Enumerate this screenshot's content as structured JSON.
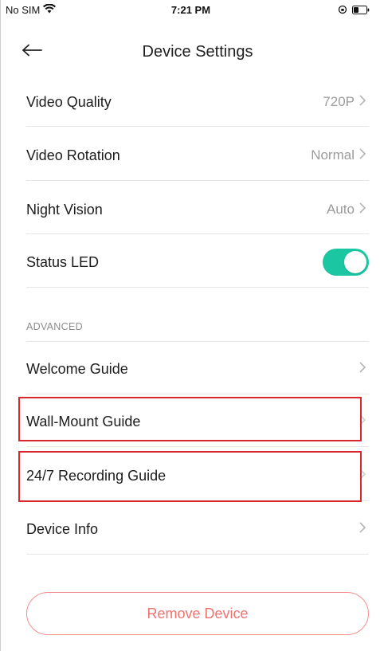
{
  "status_bar": {
    "carrier": "No SIM",
    "time": "7:21 PM",
    "wifi_icon": "wifi-icon",
    "battery_icon": "battery-icon",
    "lock_icon": "rotation-lock-icon"
  },
  "nav": {
    "title": "Device Settings",
    "back_icon": "back-arrow-icon"
  },
  "settings": {
    "video_quality": {
      "label": "Video Quality",
      "value": "720P"
    },
    "video_rotation": {
      "label": "Video Rotation",
      "value": "Normal"
    },
    "night_vision": {
      "label": "Night Vision",
      "value": "Auto"
    },
    "status_led": {
      "label": "Status LED",
      "enabled": true
    }
  },
  "advanced": {
    "header": "ADVANCED",
    "items": [
      {
        "label": "Welcome Guide"
      },
      {
        "label": "Wall-Mount Guide"
      },
      {
        "label": "24/7 Recording Guide"
      },
      {
        "label": "Device Info"
      }
    ]
  },
  "actions": {
    "remove_label": "Remove Device"
  },
  "colors": {
    "toggle_on": "#1bc7a3",
    "remove_text": "#f0726f",
    "remove_border": "#f3908f",
    "highlight": "#d8282d"
  }
}
